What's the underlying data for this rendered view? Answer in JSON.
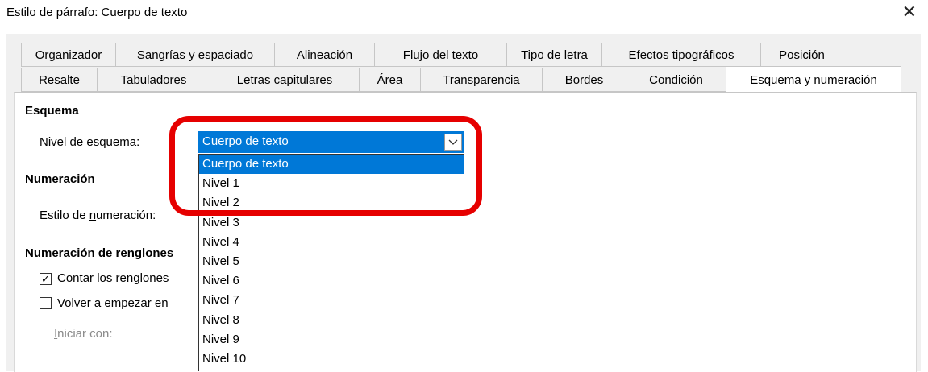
{
  "window": {
    "title": "Estilo de párrafo: Cuerpo de texto",
    "close_glyph": "✕"
  },
  "tabs_row1": [
    "Organizador",
    "Sangrías y espaciado",
    "Alineación",
    "Flujo del texto",
    "Tipo de letra",
    "Efectos tipográficos",
    "Posición"
  ],
  "tabs_row2": [
    "Resalte",
    "Tabuladores",
    "Letras capitulares",
    "Área",
    "Transparencia",
    "Bordes",
    "Condición",
    "Esquema y numeración"
  ],
  "active_tab": "Esquema y numeración",
  "esquema": {
    "heading": "Esquema",
    "nivel_label_pre": "Nivel ",
    "nivel_label_ul": "d",
    "nivel_label_post": "e esquema:",
    "selected": "Cuerpo de texto",
    "options": [
      "Cuerpo de texto",
      "Nivel 1",
      "Nivel 2",
      "Nivel 3",
      "Nivel 4",
      "Nivel 5",
      "Nivel 6",
      "Nivel 7",
      "Nivel 8",
      "Nivel 9",
      "Nivel 10"
    ]
  },
  "numeracion": {
    "heading": "Numeración",
    "estilo_pre": "Estilo de ",
    "estilo_ul": "n",
    "estilo_post": "umeración:"
  },
  "renglones": {
    "heading": "Numeración de renglones",
    "contar_pre": "Con",
    "contar_ul": "t",
    "contar_post": "ar los renglones",
    "contar_checked": true,
    "volver_pre": "Volver a empe",
    "volver_ul": "z",
    "volver_post": "ar en",
    "volver_checked": false,
    "iniciar_ul": "I",
    "iniciar_post": "niciar con:"
  },
  "colors": {
    "accent": "#0078d7",
    "highlight": "#e60000"
  }
}
